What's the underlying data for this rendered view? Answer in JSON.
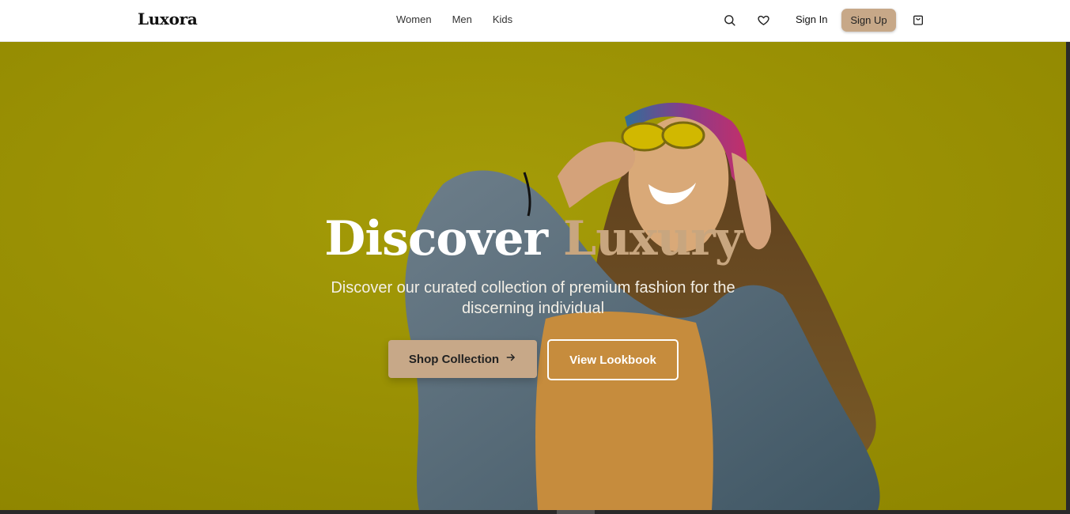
{
  "header": {
    "brand": "Luxora",
    "nav": [
      "Women",
      "Men",
      "Kids"
    ],
    "sign_in": "Sign In",
    "sign_up": "Sign Up",
    "icons": [
      "search-icon",
      "heart-icon",
      "shopping-bag-icon"
    ]
  },
  "hero": {
    "title_main": "Discover",
    "title_accent": "Luxury",
    "subtitle": "Discover our curated collection of premium fashion for the discerning individual",
    "primary_cta": "Shop Collection",
    "secondary_cta": "View Lookbook"
  },
  "colors": {
    "accent": "#c7a888",
    "hero_bg": "#9c9400",
    "title_accent": "#c8a67f"
  }
}
